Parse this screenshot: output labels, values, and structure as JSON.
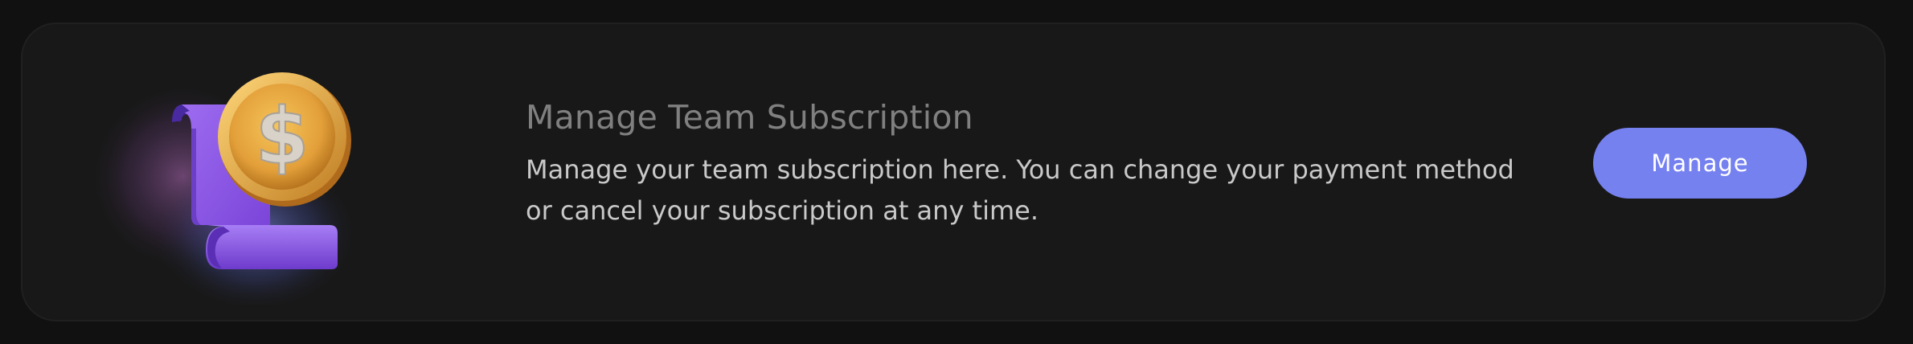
{
  "subscription_card": {
    "title": "Manage Team Subscription",
    "description": "Manage your team subscription here. You can change your payment method or cancel your subscription at any time.",
    "manage_button_label": "Manage",
    "illustration": {
      "icon": "receipt-with-dollar-coin-icon",
      "coin_symbol": "$"
    }
  },
  "colors": {
    "page_background": "#111111",
    "card_background": "#181818",
    "button_background": "#7681f0",
    "receipt_purple": "#8b5cf6",
    "coin_gold": "#e9a83a"
  }
}
